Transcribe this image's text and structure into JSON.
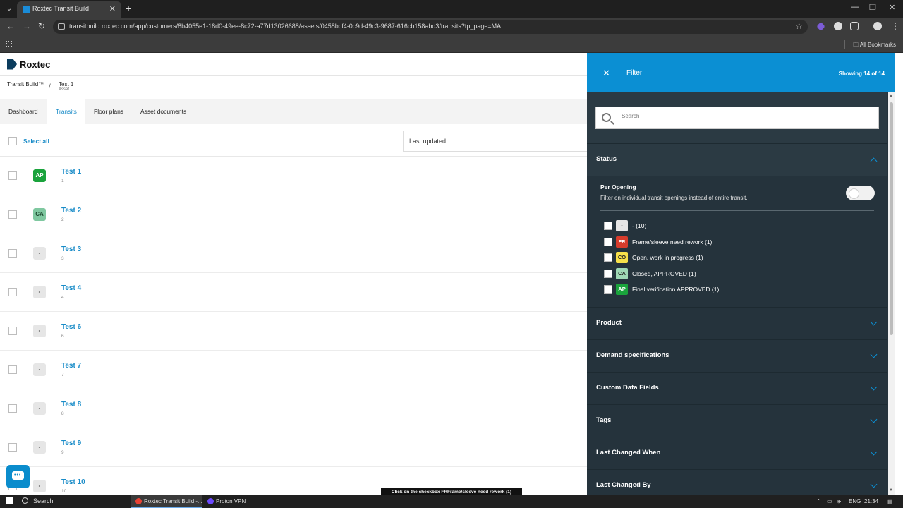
{
  "browser": {
    "tab_title": "Roxtec Transit Build",
    "url": "transitbuild.roxtec.com/app/customers/8b4055e1-18d0-49ee-8c72-a77d13026688/assets/0458bcf4-0c9d-49c3-9687-616cb158abd3/transits?tp_page=MA",
    "all_bookmarks": "All Bookmarks",
    "colors": {
      "tabbar": "#1f1f1f",
      "toolbar": "#3c3c3c"
    }
  },
  "app": {
    "logo": "Roxtec",
    "breadcrumb": {
      "root": "Transit Build™",
      "current": "Test 1",
      "current_type": "Asset",
      "separator": "/"
    },
    "tabs": [
      {
        "label": "Dashboard"
      },
      {
        "label": "Transits",
        "active": true
      },
      {
        "label": "Floor plans"
      },
      {
        "label": "Asset documents"
      }
    ],
    "select_all": "Select all",
    "sort": {
      "value": "Last updated"
    },
    "rows": [
      {
        "title": "Test 1",
        "sub": "1",
        "badge": "AP",
        "badge_color": "#1aa33c"
      },
      {
        "title": "Test 2",
        "sub": "2",
        "badge": "CA",
        "badge_color": "#7fc8a0"
      },
      {
        "title": "Test 3",
        "sub": "3",
        "badge": "-",
        "badge_color": "#e6e6e6"
      },
      {
        "title": "Test 4",
        "sub": "4",
        "badge": "-",
        "badge_color": "#e6e6e6"
      },
      {
        "title": "Test 6",
        "sub": "6",
        "badge": "-",
        "badge_color": "#e6e6e6"
      },
      {
        "title": "Test 7",
        "sub": "7",
        "badge": "-",
        "badge_color": "#e6e6e6"
      },
      {
        "title": "Test 8",
        "sub": "8",
        "badge": "-",
        "badge_color": "#e6e6e6"
      },
      {
        "title": "Test 9",
        "sub": "9",
        "badge": "-",
        "badge_color": "#e6e6e6"
      },
      {
        "title": "Test 10",
        "sub": "10",
        "badge": "-",
        "badge_color": "#e6e6e6"
      }
    ],
    "accent_color": "#1a8cc8"
  },
  "filter": {
    "title": "Filter",
    "count": "Showing 14 of 14",
    "search_placeholder": "Search",
    "status": {
      "label": "Status",
      "per_opening_label": "Per Opening",
      "per_opening_desc": "Filter on individual transit openings instead of entire transit.",
      "per_opening_on": false,
      "options": [
        {
          "badge": "-",
          "label": "- (10)",
          "color": "#e6e6e6",
          "text_color": "#333"
        },
        {
          "badge": "FR",
          "label": "Frame/sleeve need rework (1)",
          "color": "#d73c2c",
          "text_color": "#fff"
        },
        {
          "badge": "CO",
          "label": "Open, work in progress (1)",
          "color": "#f7e14a",
          "text_color": "#222"
        },
        {
          "badge": "CA",
          "label": "Closed, APPROVED (1)",
          "color": "#9fd8b5",
          "text_color": "#222"
        },
        {
          "badge": "AP",
          "label": "Final verification APPROVED (1)",
          "color": "#1aa33c",
          "text_color": "#fff"
        }
      ]
    },
    "sections": [
      {
        "label": "Product"
      },
      {
        "label": "Demand specifications"
      },
      {
        "label": "Custom Data Fields"
      },
      {
        "label": "Tags"
      },
      {
        "label": "Last Changed When"
      },
      {
        "label": "Last Changed By"
      }
    ],
    "header_color": "#0b8fd3",
    "panel_color": "#25333c"
  },
  "tooltip": "Click on the checkbox FRFrame/sleeve need rework (1)",
  "taskbar": {
    "search": "Search",
    "apps": [
      {
        "label": "Roxtec Transit Build -...",
        "active": true
      },
      {
        "label": "Proton VPN",
        "active": false
      }
    ],
    "lang": "ENG",
    "time": "21:34"
  }
}
